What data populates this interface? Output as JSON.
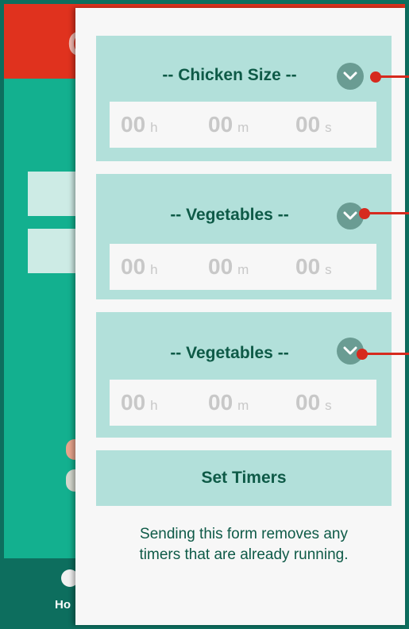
{
  "background_app": {
    "header_letter": "C",
    "nav_label": "Ho"
  },
  "cards": [
    {
      "title": "-- Chicken Size --",
      "chevron_icon": "chevron-down-icon",
      "hours": "00",
      "hours_unit": "h",
      "minutes": "00",
      "minutes_unit": "m",
      "seconds": "00",
      "seconds_unit": "s"
    },
    {
      "title": "-- Vegetables --",
      "chevron_icon": "chevron-down-icon",
      "hours": "00",
      "hours_unit": "h",
      "minutes": "00",
      "minutes_unit": "m",
      "seconds": "00",
      "seconds_unit": "s"
    },
    {
      "title": "-- Vegetables --",
      "chevron_icon": "chevron-down-icon",
      "hours": "00",
      "hours_unit": "h",
      "minutes": "00",
      "minutes_unit": "m",
      "seconds": "00",
      "seconds_unit": "s"
    }
  ],
  "set_timers_label": "Set Timers",
  "note_line1": "Sending this form removes any",
  "note_line2": "timers that are already running.",
  "colors": {
    "card": "#b2e0da",
    "text": "#0e5a47",
    "annotation": "#d62a1e",
    "header": "#e0321e",
    "app_bg": "#13b08f"
  }
}
